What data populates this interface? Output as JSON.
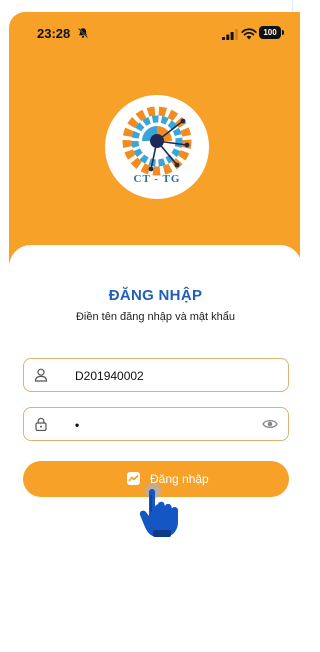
{
  "status_bar": {
    "time": "23:28",
    "bell_icon": "bell-slash-icon",
    "signal_icon": "cellular-signal-icon",
    "wifi_icon": "wifi-icon",
    "battery_level": "100"
  },
  "logo": {
    "text": "CT - TG",
    "icon": "gear-circuit-logo"
  },
  "login": {
    "title": "ĐĂNG NHẬP",
    "subtitle": "Điền tên đăng nhập và mật khẩu",
    "username_value": "D201940002",
    "username_icon": "user-icon",
    "password_value": "•",
    "password_icon": "lock-icon",
    "password_toggle_icon": "eye-icon",
    "button_label": "Đăng nhập",
    "button_icon": "messenger-icon"
  },
  "colors": {
    "accent": "#f7a128",
    "title": "#1f5fb7",
    "field_border": "#e3b070"
  }
}
